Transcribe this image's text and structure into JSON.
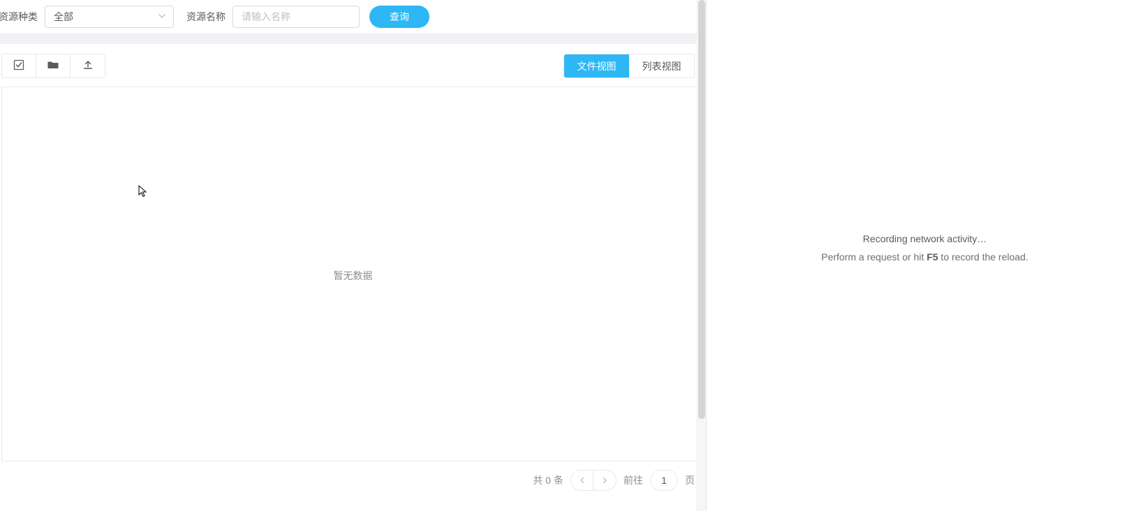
{
  "filter": {
    "type_label": "资源种类",
    "type_value": "全部",
    "name_label": "资源名称",
    "name_placeholder": "请输入名称",
    "search_label": "查询"
  },
  "toolbar": {
    "icons": {
      "select_all": "select-all-icon",
      "folder": "folder-icon",
      "upload": "upload-icon"
    }
  },
  "view_toggle": {
    "file_view": "文件视图",
    "list_view": "列表视图"
  },
  "content": {
    "empty_message": "暂无数据"
  },
  "pagination": {
    "total_text": "共 0 条",
    "goto_label": "前往",
    "page_input_value": "1",
    "page_suffix": "页"
  },
  "devtools": {
    "recording_title": "Recording network activity…",
    "hint_prefix": "Perform a request or hit ",
    "hint_key": "F5",
    "hint_suffix": " to record the reload."
  },
  "colors": {
    "primary": "#2db7f5",
    "border": "#e8e8e8",
    "text_muted": "#8c8c8c"
  }
}
